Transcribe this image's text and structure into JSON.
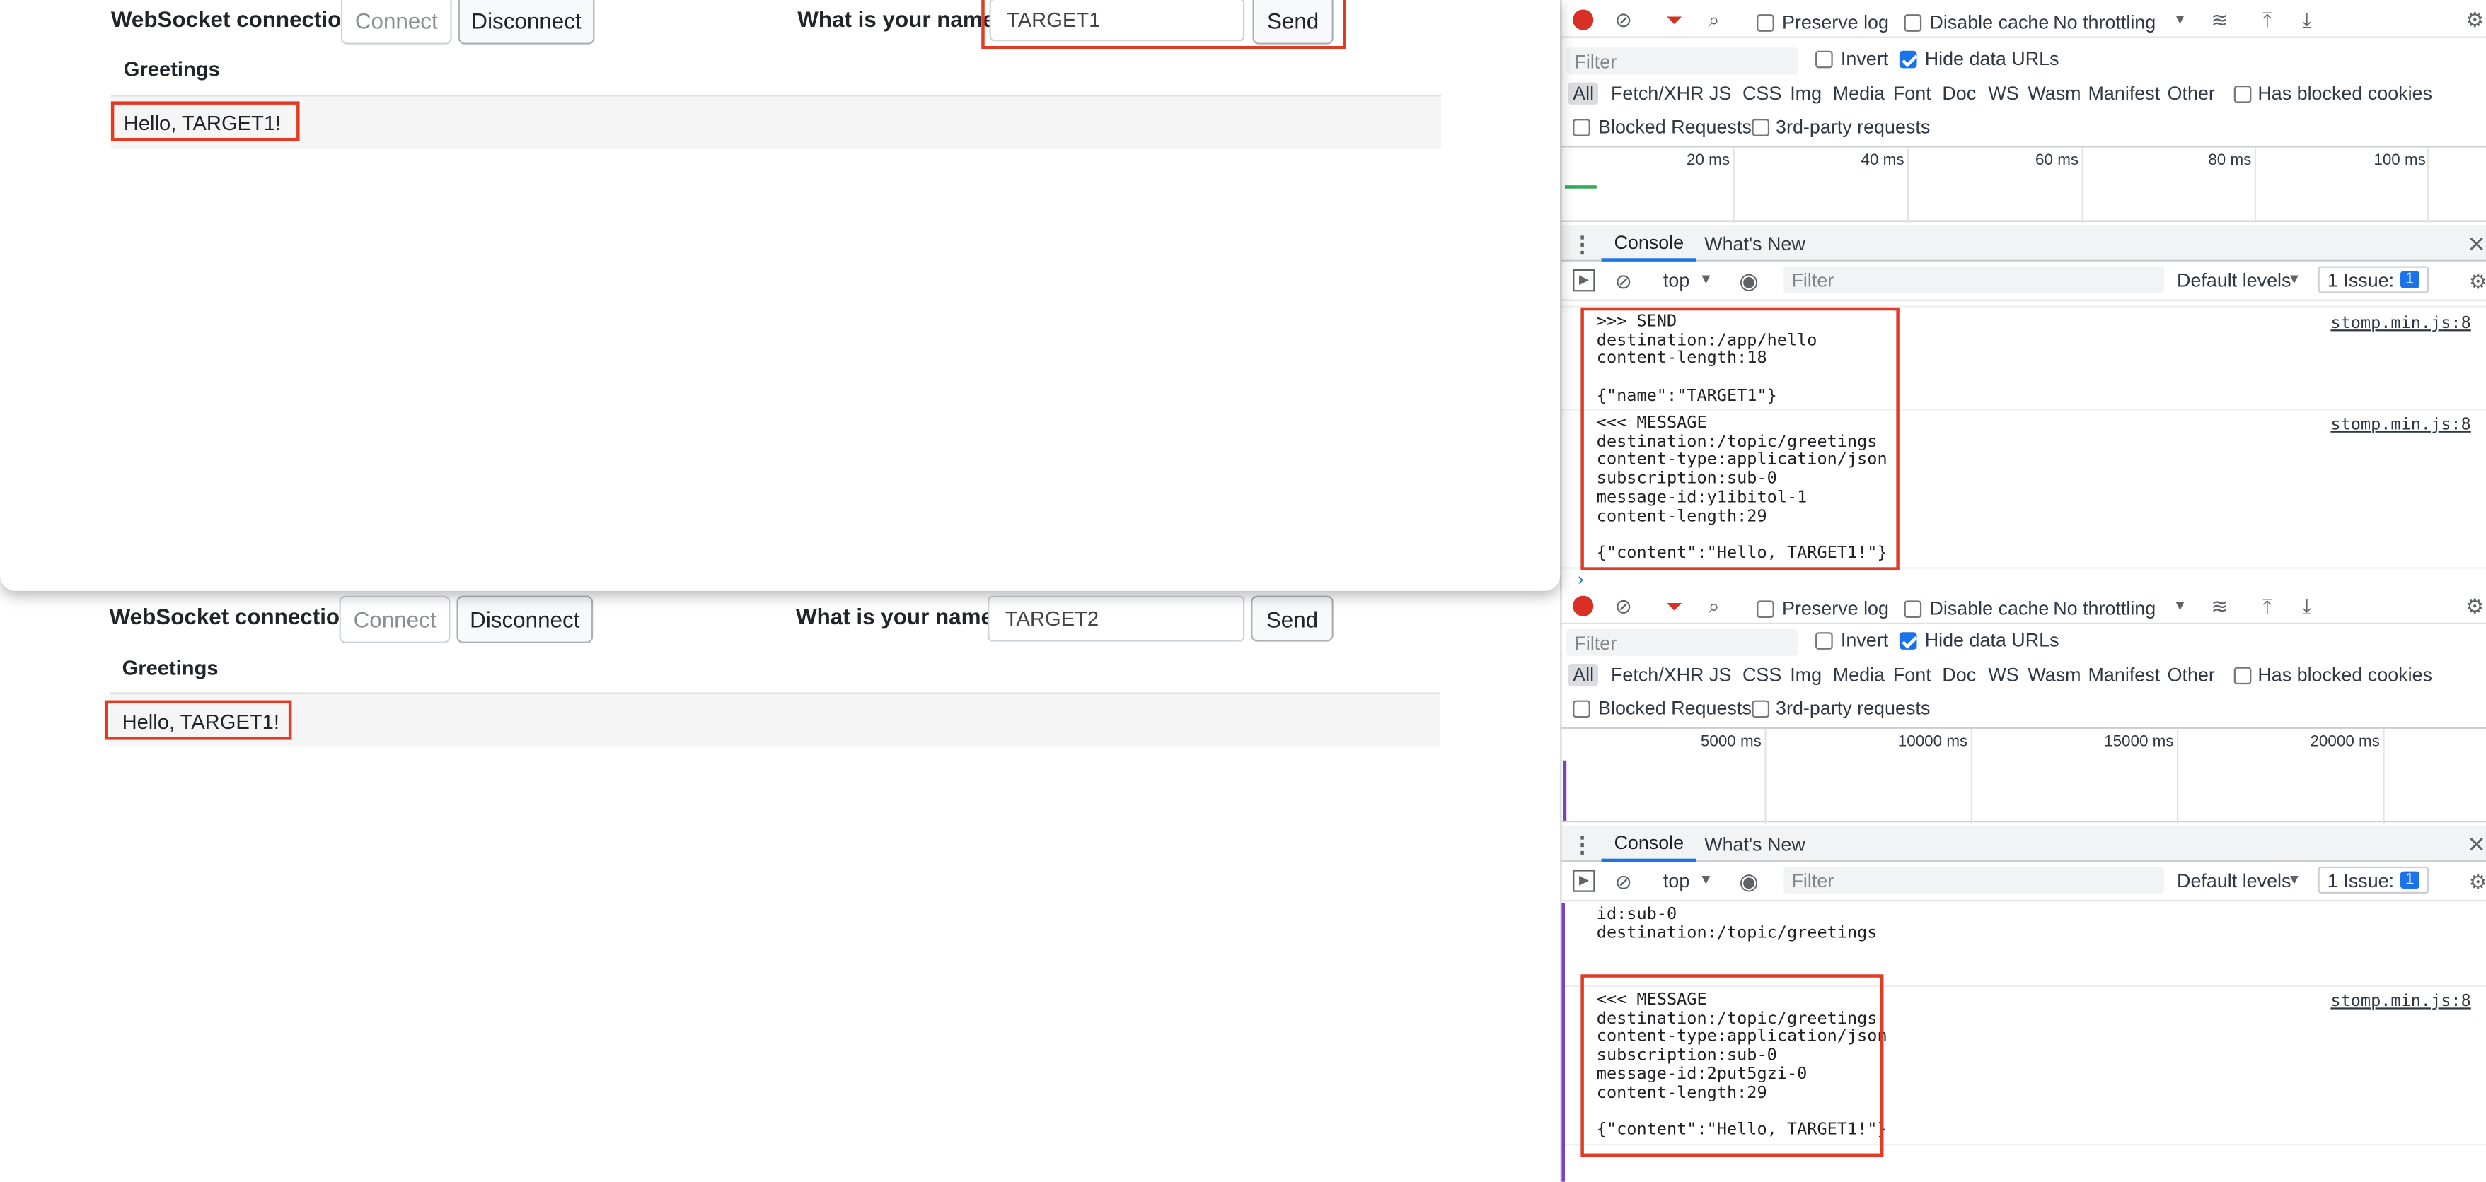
{
  "app": {
    "ws_label": "WebSocket connection:",
    "connect_label": "Connect",
    "disconnect_label": "Disconnect",
    "name_label": "What is your name?",
    "send_label": "Send",
    "greetings_header": "Greetings"
  },
  "top": {
    "name_value": "TARGET1",
    "greeting": "Hello, TARGET1!"
  },
  "bottom": {
    "name_value": "TARGET2",
    "greeting": "Hello, TARGET1!"
  },
  "devtools": {
    "preserve_log": "Preserve log",
    "disable_cache": "Disable cache",
    "throttling": "No throttling",
    "filter_placeholder": "Filter",
    "invert": "Invert",
    "hide_data_urls": "Hide data URLs",
    "types": [
      "All",
      "Fetch/XHR",
      "JS",
      "CSS",
      "Img",
      "Media",
      "Font",
      "Doc",
      "WS",
      "Wasm",
      "Manifest",
      "Other"
    ],
    "has_blocked_cookies": "Has blocked cookies",
    "blocked_requests": "Blocked Requests",
    "third_party": "3rd-party requests",
    "tab_console": "Console",
    "tab_whats_new": "What's New",
    "context": "top",
    "console_filter": "Filter",
    "levels": "Default levels",
    "issues": "1 Issue:",
    "issues_count": "1",
    "source": "stomp.min.js:8"
  },
  "top_devtools": {
    "ticks": [
      "20 ms",
      "40 ms",
      "60 ms",
      "80 ms",
      "100 ms"
    ],
    "send_message": ">>> SEND\ndestination:/app/hello\ncontent-length:18\n\n{\"name\":\"TARGET1\"}",
    "recv_message": "<<< MESSAGE\ndestination:/topic/greetings\ncontent-type:application/json\nsubscription:sub-0\nmessage-id:y1ibitol-1\ncontent-length:29\n\n{\"content\":\"Hello, TARGET1!\"}"
  },
  "bottom_devtools": {
    "ticks": [
      "5000 ms",
      "10000 ms",
      "15000 ms",
      "20000 ms"
    ],
    "subscribe_message": "id:sub-0\ndestination:/topic/greetings",
    "recv_message": "<<< MESSAGE\ndestination:/topic/greetings\ncontent-type:application/json\nsubscription:sub-0\nmessage-id:2put5gzi-0\ncontent-length:29\n\n{\"content\":\"Hello, TARGET1!\"}"
  },
  "colors": {
    "highlight": "#e03b24",
    "accent": "#1a73e8"
  }
}
